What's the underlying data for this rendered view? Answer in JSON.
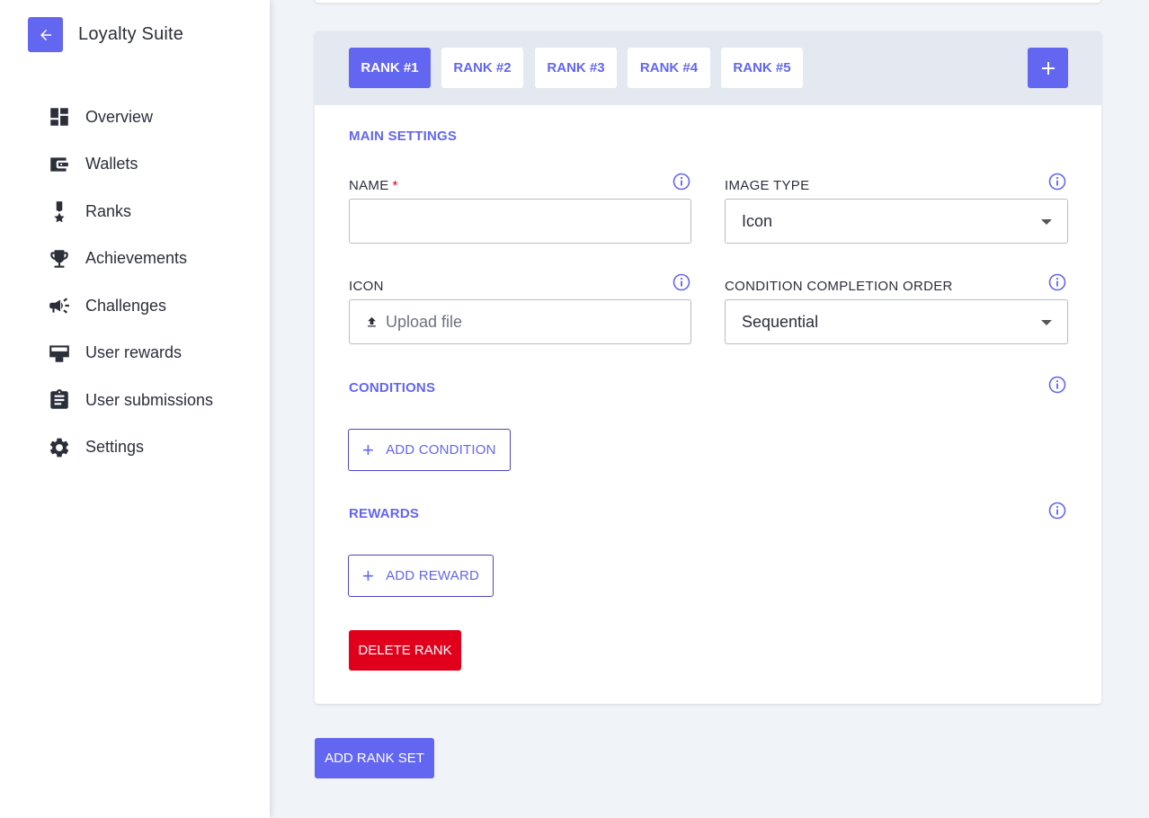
{
  "brand": {
    "title": "Loyalty Suite"
  },
  "sidebar": {
    "items": [
      {
        "label": "Overview",
        "icon": "dashboard-icon"
      },
      {
        "label": "Wallets",
        "icon": "wallet-icon"
      },
      {
        "label": "Ranks",
        "icon": "medal-icon"
      },
      {
        "label": "Achievements",
        "icon": "trophy-icon"
      },
      {
        "label": "Challenges",
        "icon": "megaphone-icon"
      },
      {
        "label": "User rewards",
        "icon": "card-giftcard-icon"
      },
      {
        "label": "User submissions",
        "icon": "clipboard-icon"
      },
      {
        "label": "Settings",
        "icon": "gear-icon"
      }
    ]
  },
  "tabs": [
    {
      "label": "RANK #1",
      "active": true
    },
    {
      "label": "RANK #2",
      "active": false
    },
    {
      "label": "RANK #3",
      "active": false
    },
    {
      "label": "RANK #4",
      "active": false
    },
    {
      "label": "RANK #5",
      "active": false
    }
  ],
  "form": {
    "main_settings_title": "MAIN SETTINGS",
    "name": {
      "label": "NAME",
      "required_mark": "*",
      "value": ""
    },
    "image_type": {
      "label": "IMAGE TYPE",
      "value": "Icon"
    },
    "icon": {
      "label": "ICON",
      "upload_text": "Upload file"
    },
    "completion_order": {
      "label": "CONDITION COMPLETION ORDER",
      "value": "Sequential"
    },
    "conditions_title": "CONDITIONS",
    "add_condition_label": "ADD CONDITION",
    "rewards_title": "REWARDS",
    "add_reward_label": "ADD REWARD",
    "delete_rank_label": "DELETE RANK"
  },
  "add_rank_set_label": "ADD RANK SET",
  "colors": {
    "accent": "#6366f1",
    "danger": "#e0001b",
    "sidebar_bg": "#ffffff",
    "page_bg": "#f0f3f8",
    "tabbar_bg": "#e3e8f1"
  }
}
